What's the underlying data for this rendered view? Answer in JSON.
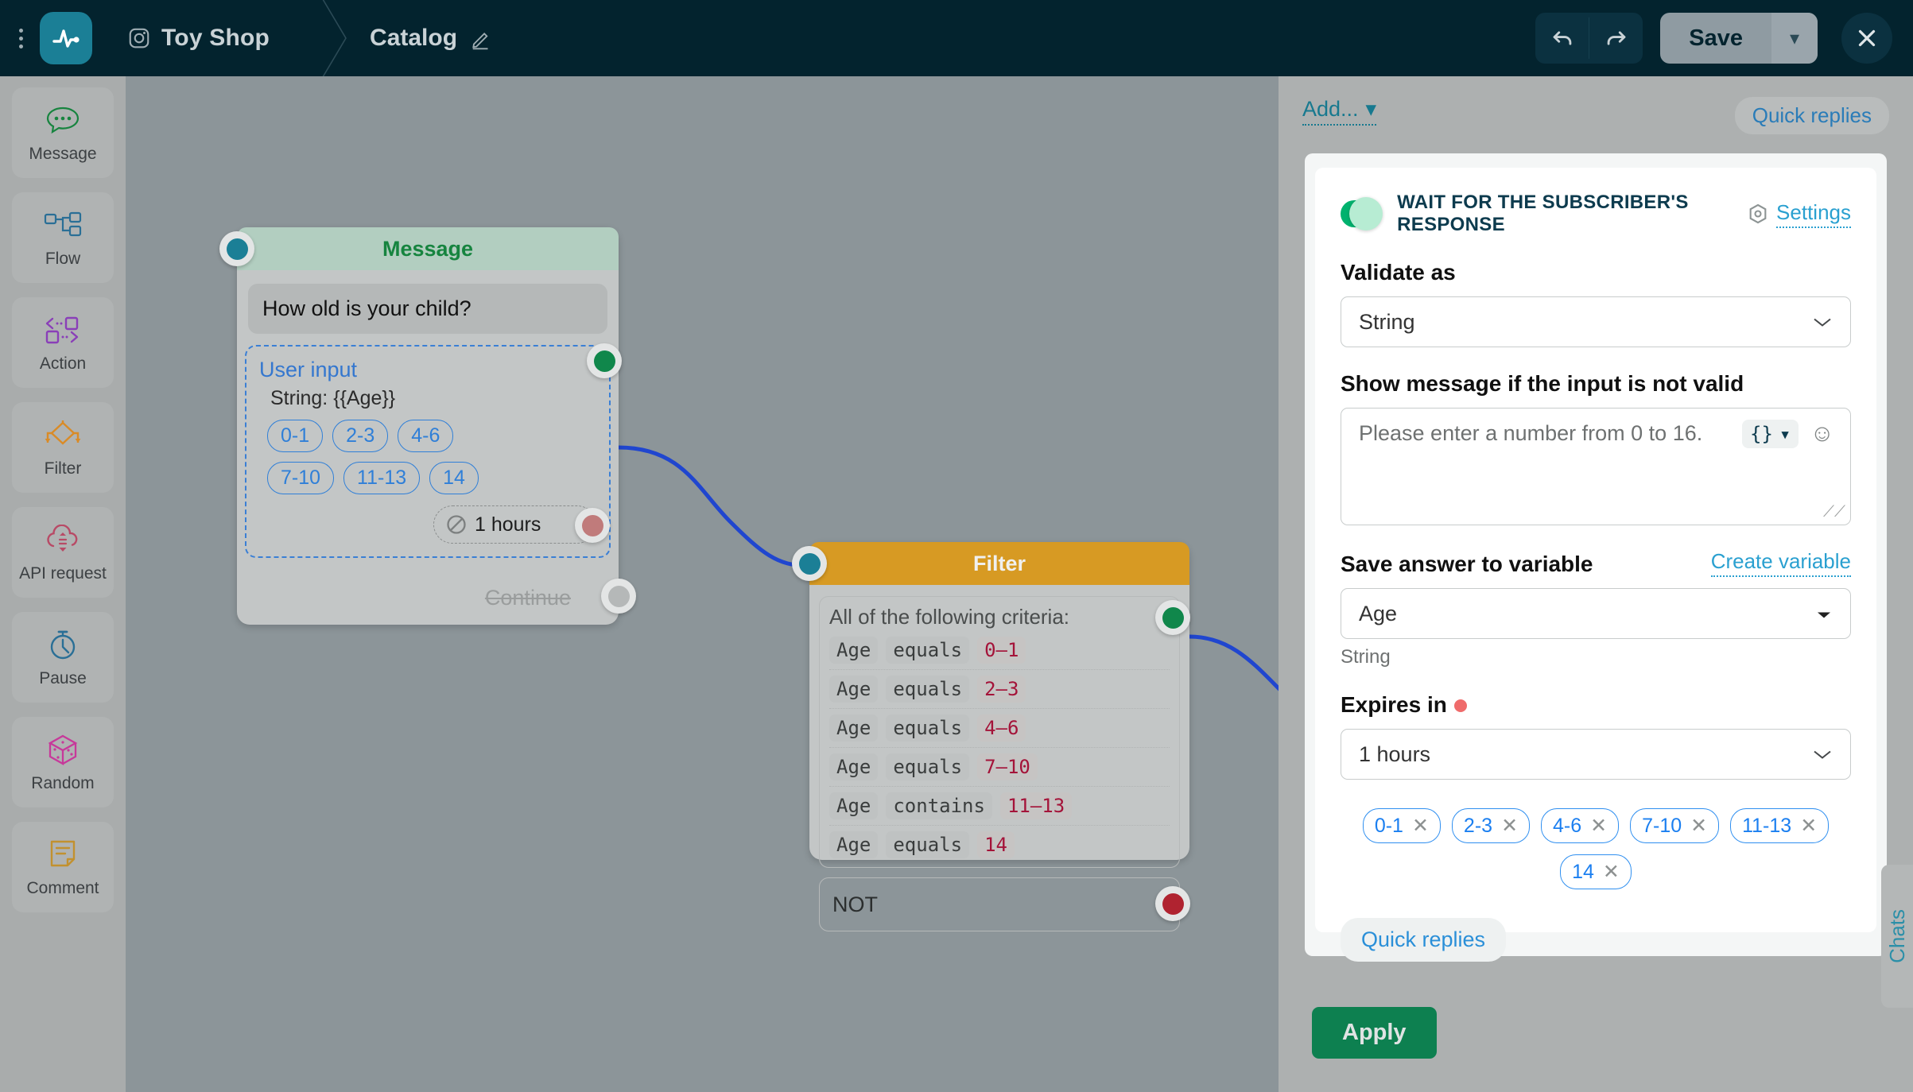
{
  "topbar": {
    "brand": "Toy Shop",
    "breadcrumb": "Catalog",
    "undo_title": "Undo",
    "redo_title": "Redo",
    "save_label": "Save",
    "save_caret": "▾",
    "close_label": "✕"
  },
  "sidebar": {
    "items": [
      {
        "label": "Message",
        "icon": "chat-bubble-icon",
        "color": "#17843f"
      },
      {
        "label": "Flow",
        "icon": "flow-nodes-icon",
        "color": "#2a6f96"
      },
      {
        "label": "Action",
        "icon": "action-arrows-icon",
        "color": "#8a3fb8"
      },
      {
        "label": "Filter",
        "icon": "filter-diamond-icon",
        "color": "#d98b27"
      },
      {
        "label": "API request",
        "icon": "cloud-sync-icon",
        "color": "#b84a66"
      },
      {
        "label": "Pause",
        "icon": "stopwatch-icon",
        "color": "#2a6f96"
      },
      {
        "label": "Random",
        "icon": "dice-icon",
        "color": "#c7399a"
      },
      {
        "label": "Comment",
        "icon": "note-icon",
        "color": "#c2912f"
      }
    ]
  },
  "canvas": {
    "message_node": {
      "title": "Message",
      "bubble_text": "How old is your child?",
      "user_input_title": "User input",
      "user_input_sub": "String: {{Age}}",
      "quick_replies": [
        "0-1",
        "2-3",
        "4-6",
        "7-10",
        "11-13",
        "14"
      ],
      "expires_label": "1 hours",
      "continue_label": "Continue"
    },
    "filter_node": {
      "title": "Filter",
      "criteria_title": "All of the following criteria:",
      "criteria": [
        {
          "field": "Age",
          "op": "equals",
          "value": "0–1"
        },
        {
          "field": "Age",
          "op": "equals",
          "value": "2–3"
        },
        {
          "field": "Age",
          "op": "equals",
          "value": "4–6"
        },
        {
          "field": "Age",
          "op": "equals",
          "value": "7–10"
        },
        {
          "field": "Age",
          "op": "contains",
          "value": "11–13"
        },
        {
          "field": "Age",
          "op": "equals",
          "value": "14"
        }
      ],
      "not_label": "NOT"
    }
  },
  "panel": {
    "add_label": "Add...",
    "add_caret": "▾",
    "quick_replies_pill": "Quick replies",
    "wait_toggle_label": "WAIT FOR THE SUBSCRIBER'S RESPONSE",
    "settings_label": "Settings",
    "validate_as_label": "Validate as",
    "validate_as_value": "String",
    "invalid_message_label": "Show message if the input is not valid",
    "invalid_message_placeholder": "Please enter a number from 0 to 16.",
    "code_chip": "{}",
    "code_chip_caret": "▾",
    "emoji_icon": "☺",
    "save_variable_label": "Save answer to variable",
    "create_variable_label": "Create variable",
    "save_variable_value": "Age",
    "save_variable_hint": "String",
    "expires_in_label": "Expires in",
    "expires_in_value": "1 hours",
    "reply_chips": [
      "0-1",
      "2-3",
      "4-6",
      "7-10",
      "11-13",
      "14"
    ],
    "chip_remove": "✕",
    "quick_replies_button": "Quick replies",
    "apply_label": "Apply"
  },
  "chats_tab": {
    "label": "Chats"
  },
  "colors": {
    "topbar_bg": "#03232e",
    "canvas_bg": "#8c9599",
    "panel_bg": "#adb0b0",
    "accent_teal": "#17798f",
    "accent_blue": "#2f8ff0",
    "green": "#0d8050",
    "filter_orange": "#d79a23",
    "message_green": "#b2cec0",
    "wire_blue": "#2046cf",
    "red_dot": "#ef6b6b"
  }
}
